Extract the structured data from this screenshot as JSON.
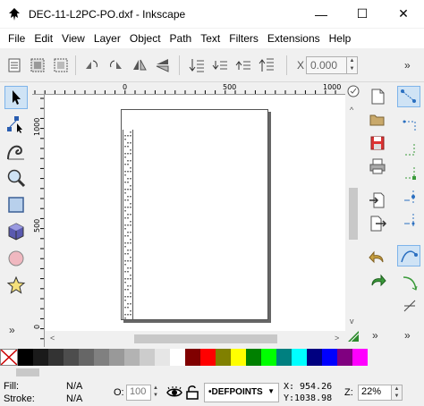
{
  "window": {
    "title": "DEC-11-L2PC-PO.dxf - Inkscape",
    "minimize_label": "—",
    "maximize_label": "☐",
    "close_label": "✕"
  },
  "menu": {
    "items": [
      {
        "label": "File"
      },
      {
        "label": "Edit"
      },
      {
        "label": "View"
      },
      {
        "label": "Layer"
      },
      {
        "label": "Object"
      },
      {
        "label": "Path"
      },
      {
        "label": "Text"
      },
      {
        "label": "Filters"
      },
      {
        "label": "Extensions"
      },
      {
        "label": "Help"
      }
    ]
  },
  "toolbar": {
    "x_label": "X",
    "x_value": "0.000",
    "more_label": "»"
  },
  "rulers": {
    "h_ticks": [
      "0",
      "500",
      "1000"
    ],
    "v_ticks": [
      "1000",
      "500",
      "0"
    ]
  },
  "palette": {
    "colors": [
      "#000000",
      "#1a1a1a",
      "#333333",
      "#4d4d4d",
      "#666666",
      "#808080",
      "#999999",
      "#b3b3b3",
      "#cccccc",
      "#e6e6e6",
      "#ffffff",
      "#800000",
      "#ff0000",
      "#808000",
      "#ffff00",
      "#008000",
      "#00ff00",
      "#008080",
      "#00ffff",
      "#000080",
      "#0000ff",
      "#800080",
      "#ff00ff"
    ]
  },
  "status": {
    "fill_label": "Fill:",
    "fill_value": "N/A",
    "stroke_label": "Stroke:",
    "stroke_value": "N/A",
    "opacity_label": "O:",
    "opacity_value": "100",
    "layer_name": "•DEFPOINTS",
    "x_label": "X:",
    "x_value": "954.26",
    "y_label": "Y:",
    "y_value": "1038.98",
    "zoom_label": "Z:",
    "zoom_value": "22%"
  }
}
